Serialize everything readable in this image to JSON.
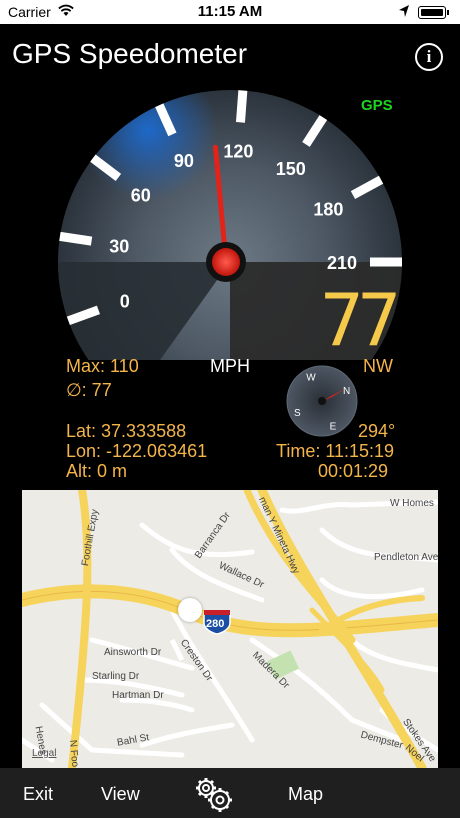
{
  "status_bar": {
    "carrier": "Carrier",
    "time": "11:15 AM"
  },
  "header": {
    "title": "GPS Speedometer",
    "info_icon": "info-icon"
  },
  "gauge": {
    "gps_label": "GPS",
    "ticks": [
      "0",
      "30",
      "60",
      "90",
      "120",
      "150",
      "180",
      "210"
    ],
    "unit": "MPH",
    "needle_value": 110,
    "needle_color": "#e2231a",
    "digital_speed": "77",
    "heading_label": "NW"
  },
  "stats": {
    "max": "Max: 110",
    "avg": "∅: 77",
    "lat": "Lat: 37.333588",
    "lon": "Lon: -122.063461",
    "alt": "Alt: 0 m",
    "bearing": "294°",
    "time": "Time: 11:15:19",
    "duration": "00:01:29"
  },
  "compass": {
    "letters": [
      "N",
      "E",
      "S",
      "W"
    ],
    "heading": 294
  },
  "map": {
    "streets": [
      "Foothill Expy",
      "Barranca Dr",
      "Wallace Dr",
      "Ainsworth Dr",
      "Creston Dr",
      "Starling Dr",
      "Hartman Dr",
      "Bahl St",
      "Madera Dr",
      "Pendleton Ave",
      "W Homes",
      "man Y Mineta Hwy",
      "Dempster",
      "Stokes Ave",
      "Noel",
      "Henes",
      "N Foo"
    ],
    "highway_shield": "280",
    "legal": "Legal"
  },
  "tab_bar": {
    "exit": "Exit",
    "view": "View",
    "map": "Map",
    "settings_icon": "gears-icon"
  },
  "colors": {
    "accent_orange": "#f3b44a",
    "gps_green": "#1fd41f",
    "digital": "#f5c94a"
  }
}
